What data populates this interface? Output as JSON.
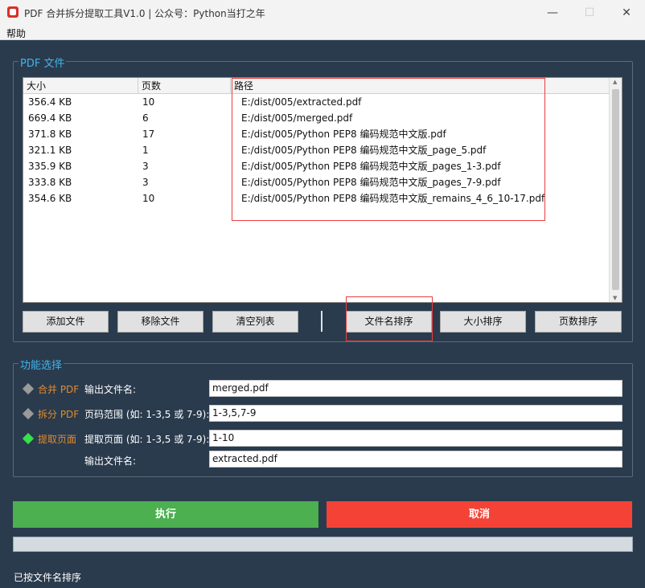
{
  "window": {
    "title": "PDF 合并拆分提取工具V1.0 | 公众号：Python当打之年",
    "minimize_glyph": "—",
    "maximize_glyph": "☐",
    "close_glyph": "✕"
  },
  "menu": {
    "help": "帮助"
  },
  "pdf_group": {
    "title": "PDF 文件"
  },
  "table": {
    "columns": [
      "大小",
      "页数",
      "路径"
    ],
    "rows": [
      [
        "356.4 KB",
        "10",
        "E:/dist/005/extracted.pdf"
      ],
      [
        "669.4 KB",
        "6",
        "E:/dist/005/merged.pdf"
      ],
      [
        "371.8 KB",
        "17",
        "E:/dist/005/Python PEP8 编码规范中文版.pdf"
      ],
      [
        "321.1 KB",
        "1",
        "E:/dist/005/Python PEP8 编码规范中文版_page_5.pdf"
      ],
      [
        "335.9 KB",
        "3",
        "E:/dist/005/Python PEP8 编码规范中文版_pages_1-3.pdf"
      ],
      [
        "333.8 KB",
        "3",
        "E:/dist/005/Python PEP8 编码规范中文版_pages_7-9.pdf"
      ],
      [
        "354.6 KB",
        "10",
        "E:/dist/005/Python PEP8 编码规范中文版_remains_4_6_10-17.pdf"
      ]
    ]
  },
  "file_buttons": {
    "add": "添加文件",
    "remove": "移除文件",
    "clear": "清空列表",
    "sort_name": "文件名排序",
    "sort_size": "大小排序",
    "sort_pages": "页数排序"
  },
  "func_group": {
    "title": "功能选择",
    "merge": {
      "radio": "合并 PDF",
      "label": "输出文件名:",
      "value": "merged.pdf"
    },
    "split": {
      "radio": "拆分 PDF",
      "label": "页码范围 (如: 1-3,5 或 7-9):",
      "value": "1-3,5,7-9"
    },
    "extract": {
      "radio": "提取页面",
      "label": "提取页面 (如: 1-3,5 或 7-9):",
      "value": "1-10",
      "out_label": "输出文件名:",
      "out_value": "extracted.pdf"
    },
    "selected": "extract"
  },
  "actions": {
    "execute": "执行",
    "cancel": "取消"
  },
  "progress": {
    "value": 0
  },
  "status": "已按文件名排序",
  "colors": {
    "execute": "#4caf50",
    "cancel": "#f44336",
    "radio_selected": "#38e04a",
    "radio_unselected": "#9a9a9a",
    "highlight_box": "#ea3e3e"
  }
}
